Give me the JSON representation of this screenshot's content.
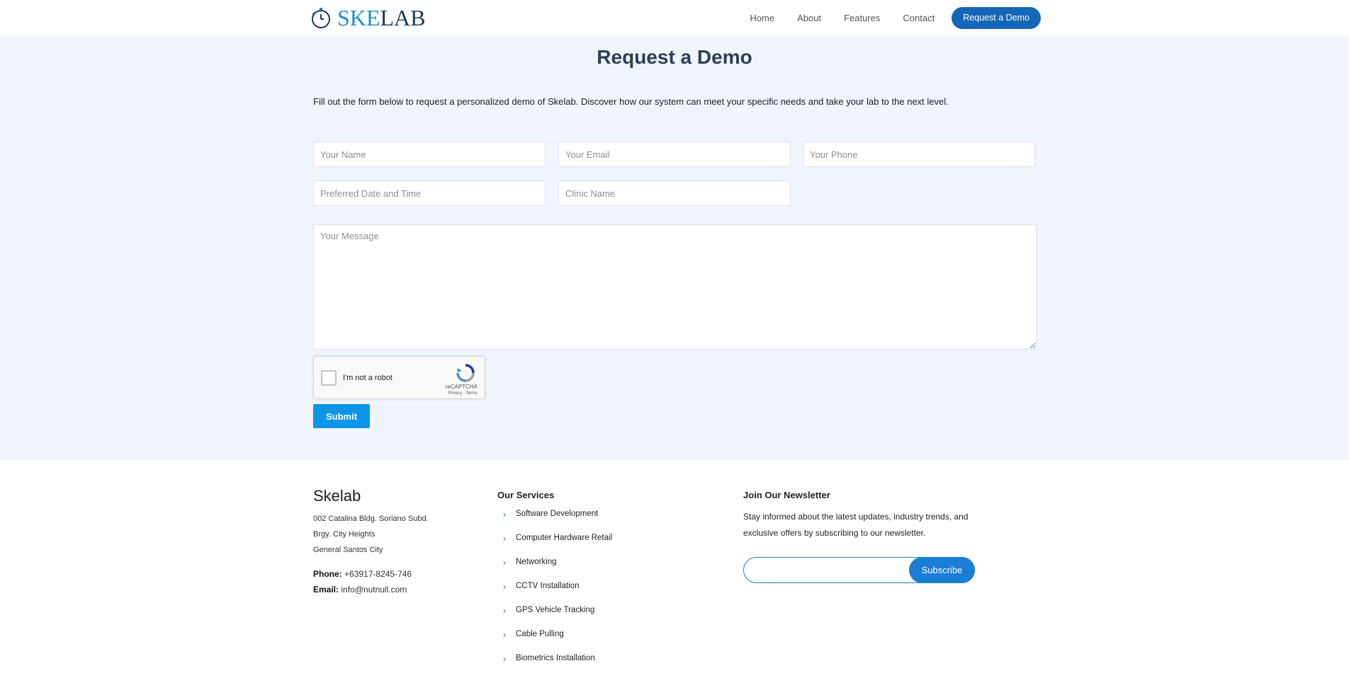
{
  "header": {
    "logo": {
      "part1": "SKE",
      "part2": "LAB",
      "icon": "stopwatch-icon"
    },
    "nav": [
      {
        "label": "Home"
      },
      {
        "label": "About"
      },
      {
        "label": "Features"
      },
      {
        "label": "Contact"
      }
    ],
    "cta_label": "Request a Demo"
  },
  "main": {
    "title": "Request a Demo",
    "intro": "Fill out the form below to request a personalized demo of Skelab. Discover how our system can meet your specific needs and take your lab to the next level.",
    "form": {
      "name_placeholder": "Your Name",
      "email_placeholder": "Your Email",
      "phone_placeholder": "Your Phone",
      "datetime_placeholder": "Preferred Date and Time",
      "clinic_placeholder": "Clinic Name",
      "message_placeholder": "Your Message",
      "captcha_label": "I'm not a robot",
      "captcha_brand": "reCAPTCHA",
      "captcha_terms": "Privacy - Terms",
      "submit_label": "Submit"
    }
  },
  "footer": {
    "brand": "Skelab",
    "address": [
      "002 Catalina Bldg. Soriano Subd.",
      "Brgy. City Heights",
      "General Santos City"
    ],
    "phone_label": "Phone:",
    "phone": "+63917-8245-746",
    "email_label": "Email:",
    "email": "info@nutnull.com",
    "services_heading": "Our Services",
    "services": [
      "Software Development",
      "Computer Hardware Retail",
      "Networking",
      "CCTV Installation",
      "GPS Vehicle Tracking",
      "Cable Pulling",
      "Biometrics Installation"
    ],
    "newsletter_heading": "Join Our Newsletter",
    "newsletter_text": "Stay informed about the latest updates, industry trends, and exclusive offers by subscribing to our newsletter.",
    "subscribe_label": "Subscribe"
  },
  "colors": {
    "brand_blue": "#1466b6",
    "accent_blue": "#0d95e8",
    "page_bg": "#f0f5fd",
    "title": "#283f58"
  }
}
